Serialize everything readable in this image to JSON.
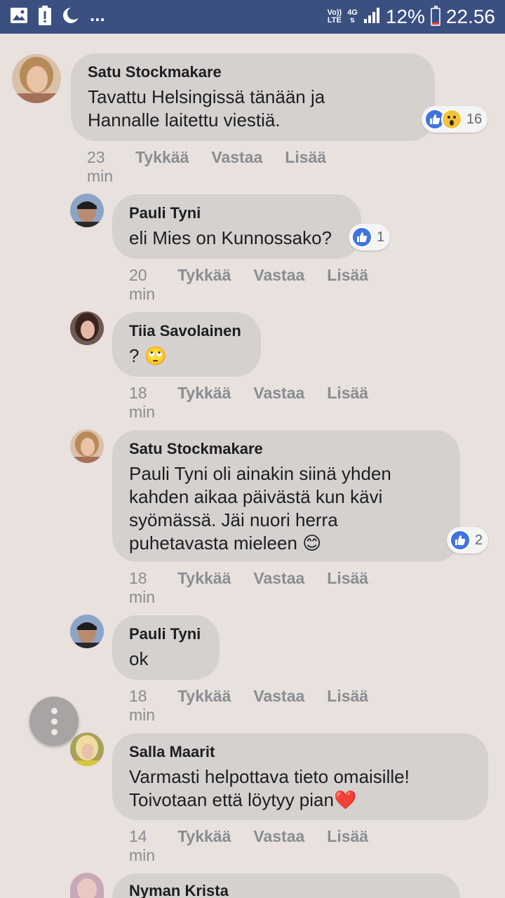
{
  "status_bar": {
    "icons_left": [
      "image-icon",
      "battery-alert-icon",
      "moon-icon"
    ],
    "more": "...",
    "network_top": "Vo))",
    "network_bottom": "LTE",
    "data_type": "4G",
    "battery_percent": "12%",
    "battery_level": 0.12,
    "time": "22.56"
  },
  "comments": [
    {
      "author": "Satu Stockmakare",
      "text_lines": [
        "Tavattu Helsingissä tänään ja",
        "Hannalle laitettu viestiä."
      ],
      "time": "23 min",
      "reaction_count": "16",
      "reactions": [
        "like",
        "wow"
      ]
    },
    {
      "author": "Pauli Tyni",
      "text_lines": [
        "eli Mies on Kunnossako?"
      ],
      "time": "20 min",
      "reaction_count": "1",
      "reactions": [
        "like"
      ]
    },
    {
      "author": "Tiia Savolainen",
      "text_lines": [
        "? 🙄"
      ],
      "time": "18 min"
    },
    {
      "author": "Satu Stockmakare",
      "text_lines": [
        "Pauli Tyni oli ainakin siinä yhden",
        "kahden aikaa päivästä kun kävi",
        "syömässä. Jäi nuori herra",
        "puhetavasta mieleen 😊"
      ],
      "time": "18 min",
      "reaction_count": "2",
      "reactions": [
        "like"
      ]
    },
    {
      "author": "Pauli Tyni",
      "text_lines": [
        "ok"
      ],
      "time": "18 min"
    },
    {
      "author": "Salla Maarit",
      "text_lines": [
        "Varmasti helpottava tieto omaisille!",
        "Toivotaan että löytyy pian❤️"
      ],
      "time": "14 min"
    },
    {
      "author": "Nyman Krista"
    }
  ],
  "actions": {
    "like": "Tykkää",
    "reply": "Vastaa",
    "more": "Lisää"
  },
  "colors": {
    "status_bar": "#3b4f81",
    "background": "#e8e1de",
    "bubble": "#d5d1cf",
    "like_blue": "#3f74e0"
  }
}
